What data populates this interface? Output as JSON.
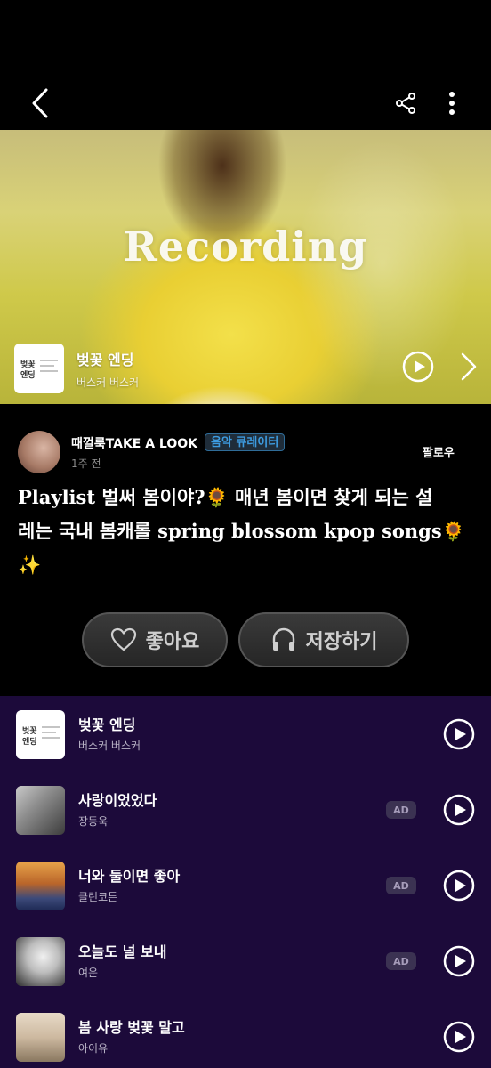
{
  "header": {
    "back_icon": "back-arrow-icon",
    "share_icon": "share-icon",
    "more_icon": "more-vertical-icon"
  },
  "hero": {
    "title": "Recording",
    "now_playing": {
      "logo_text": "벚꽃엔딩",
      "title": "벚꽃 엔딩",
      "artist": "버스커 버스커"
    }
  },
  "curator": {
    "name": "때껄룩TAKE A LOOK",
    "badge": "음악 큐레이터",
    "time": "1주 전",
    "follow_label": "팔로우"
  },
  "playlist": {
    "line1": "Playlist 벌써 봄이야?",
    "line1_emoji": "🌻",
    "line1_rest": " 매년 봄이면 찾게 되는 설",
    "line2": "레는 국내 봄캐롤 spring blossom kpop songs",
    "line2_emoji": "🌻",
    "line3_emoji": "✨"
  },
  "actions": {
    "like_label": "좋아요",
    "save_label": "저장하기"
  },
  "tracks": [
    {
      "title": "벚꽃 엔딩",
      "artist": "버스커 버스커",
      "ad": ""
    },
    {
      "title": "사랑이었었다",
      "artist": "장동욱",
      "ad": "AD"
    },
    {
      "title": "너와 둘이면 좋아",
      "artist": "클린코튼",
      "ad": "AD"
    },
    {
      "title": "오늘도 널 보내",
      "artist": "여운",
      "ad": "AD"
    },
    {
      "title": "봄 사랑 벚꽃 말고",
      "artist": "아이유",
      "ad": ""
    }
  ],
  "colors": {
    "list_background": "#1c0a3a",
    "badge_text": "#3d9bdf",
    "accent_yellow": "#f2c21b"
  }
}
